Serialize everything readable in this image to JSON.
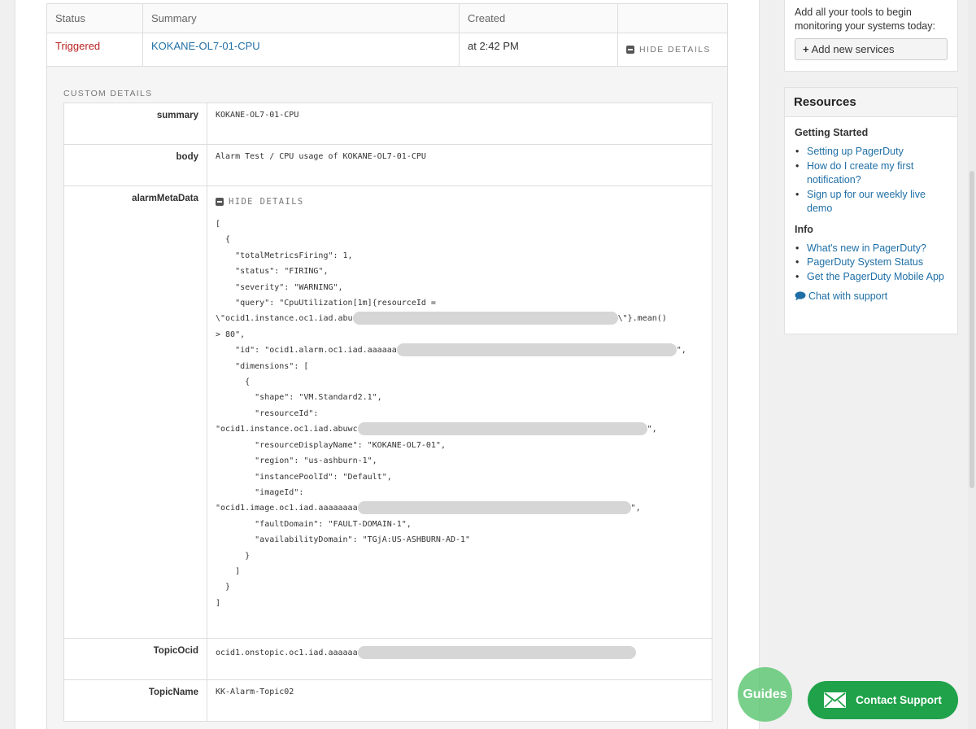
{
  "incident": {
    "headers": {
      "status": "Status",
      "summary": "Summary",
      "created": "Created"
    },
    "status": "Triggered",
    "summary": "KOKANE-OL7-01-CPU",
    "created": "at 2:42 PM",
    "hide_details": "HIDE DETAILS"
  },
  "custom_details": {
    "label": "CUSTOM DETAILS",
    "summary": {
      "key": "summary",
      "value": "KOKANE-OL7-01-CPU"
    },
    "body": {
      "key": "body",
      "value": "Alarm Test / CPU usage of KOKANE-OL7-01-CPU"
    },
    "alarm": {
      "key": "alarmMetaData",
      "hide_details": "HIDE DETAILS",
      "json": {
        "l1": "[",
        "l2": "  {",
        "l3": "    \"totalMetricsFiring\": 1,",
        "l4": "    \"status\": \"FIRING\",",
        "l5": "    \"severity\": \"WARNING\",",
        "l6": "    \"query\": \"CpuUtilization[1m]{resourceId =",
        "l7a": "\\\"ocid1.instance.oc1.iad.abu",
        "l7b": "\\\"}.mean()",
        "l8": "> 80\",",
        "l9a": "    \"id\": \"ocid1.alarm.oc1.iad.aaaaaa",
        "l9b": "\",",
        "l10": "    \"dimensions\": [",
        "l11": "      {",
        "l12": "        \"shape\": \"VM.Standard2.1\",",
        "l13": "        \"resourceId\":",
        "l14a": "\"ocid1.instance.oc1.iad.abuwc",
        "l14b": "\",",
        "l15": "        \"resourceDisplayName\": \"KOKANE-OL7-01\",",
        "l16": "        \"region\": \"us-ashburn-1\",",
        "l17": "        \"instancePoolId\": \"Default\",",
        "l18": "        \"imageId\":",
        "l19a": "\"ocid1.image.oc1.iad.aaaaaaaa",
        "l19b": "\",",
        "l20": "        \"faultDomain\": \"FAULT-DOMAIN-1\",",
        "l21": "        \"availabilityDomain\": \"TGjA:US-ASHBURN-AD-1\"",
        "l22": "      }",
        "l23": "    ]",
        "l24": "  }",
        "l25": "]"
      }
    },
    "topic_ocid": {
      "key": "TopicOcid",
      "value": "ocid1.onstopic.oc1.iad.aaaaaa"
    },
    "topic_name": {
      "key": "TopicName",
      "value": "KK-Alarm-Topic02"
    }
  },
  "sidebar": {
    "tools_text": "Add all your tools to begin monitoring your systems today:",
    "add_services": "Add new services",
    "resources_title": "Resources",
    "getting_started": "Getting Started",
    "gs_links": [
      "Setting up PagerDuty",
      "How do I create my first notification?",
      "Sign up for our weekly live demo"
    ],
    "info": "Info",
    "info_links": [
      "What's new in PagerDuty?",
      "PagerDuty System Status",
      "Get the PagerDuty Mobile App"
    ],
    "chat": "Chat with support"
  },
  "widgets": {
    "guides": "Guides",
    "contact_support": "Contact Support"
  },
  "colors": {
    "triggered": "#bb2222",
    "link": "#1f6fa6",
    "contact_button": "#1fa24a",
    "guides_button": "#5cc671"
  }
}
